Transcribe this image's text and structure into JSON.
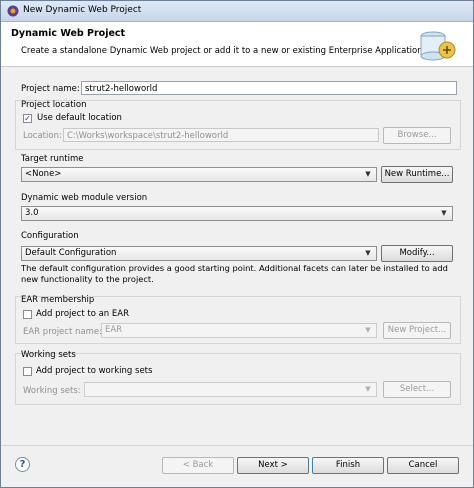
{
  "window": {
    "title": "New Dynamic Web Project"
  },
  "header": {
    "title": "Dynamic Web Project",
    "description": "Create a standalone Dynamic Web project or add it to a new or existing Enterprise Application."
  },
  "project_name": {
    "label": "Project name:",
    "value": "strut2-helloworld"
  },
  "project_location": {
    "group_label": "Project location",
    "use_default_label": "Use default location",
    "use_default_checked": true,
    "location_label": "Location:",
    "location_value": "C:\\Works\\workspace\\strut2-helloworld",
    "browse_label": "Browse..."
  },
  "target_runtime": {
    "group_label": "Target runtime",
    "value": "<None>",
    "new_runtime_label": "New Runtime..."
  },
  "module_version": {
    "group_label": "Dynamic web module version",
    "value": "3.0"
  },
  "configuration": {
    "group_label": "Configuration",
    "value": "Default Configuration",
    "modify_label": "Modify...",
    "description": "The default configuration provides a good starting point. Additional facets can later be installed to add new functionality to the project."
  },
  "ear_membership": {
    "group_label": "EAR membership",
    "add_label": "Add project to an EAR",
    "add_checked": false,
    "project_name_label": "EAR project name:",
    "project_name_value": "EAR",
    "new_project_label": "New Project..."
  },
  "working_sets": {
    "group_label": "Working sets",
    "add_label": "Add project to working sets",
    "add_checked": false,
    "sets_label": "Working sets:",
    "sets_value": "",
    "select_label": "Select..."
  },
  "footer": {
    "help_glyph": "?",
    "back_label": "< Back",
    "next_label": "Next >",
    "finish_label": "Finish",
    "cancel_label": "Cancel"
  },
  "icons": [
    "app-icon",
    "wizard-banner-icon",
    "help-icon",
    "checkmark-icon",
    "dropdown-arrow-icon"
  ],
  "colors": {
    "title_gradient_top": "#dfe9f5",
    "title_gradient_bottom": "#c6d6ea",
    "dialog_bg": "#f0f0f0",
    "default_button_border": "#3c7fb1"
  }
}
